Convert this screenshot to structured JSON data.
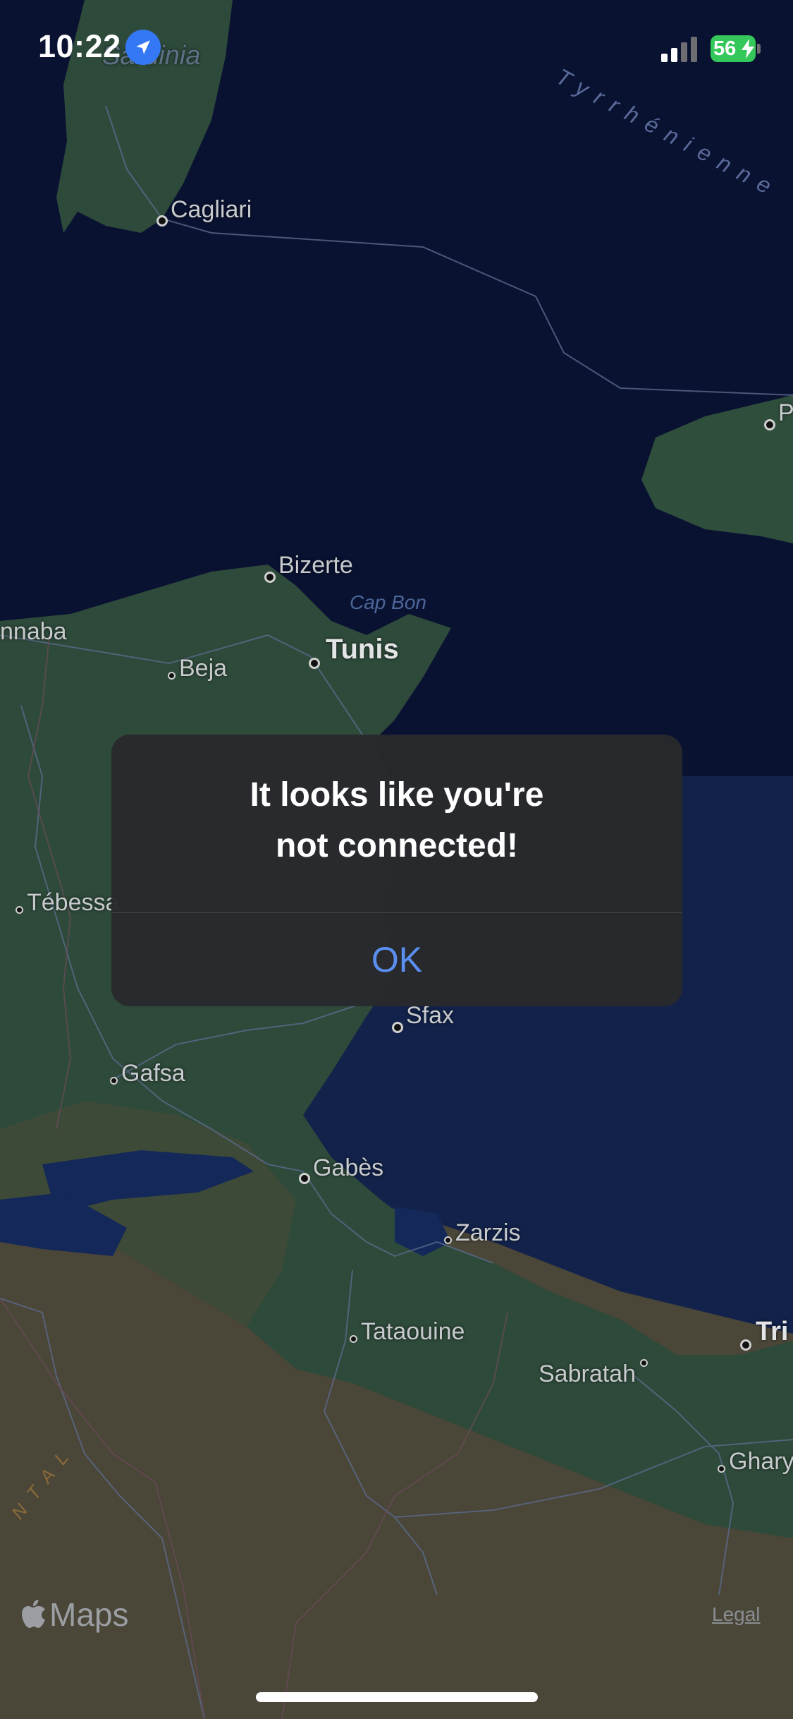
{
  "status_bar": {
    "time": "10:22",
    "battery_level": "56",
    "icons": [
      "location-arrow-icon",
      "signal-icon",
      "battery-charging-icon"
    ]
  },
  "map": {
    "places": {
      "sardinia": "Sardinia",
      "tyrrhenian": "Tyrrhénienne",
      "cagliari": "Cagliari",
      "palermo": "P",
      "bizerte": "Bizerte",
      "cap_bon": "Cap Bon",
      "annaba": "nnaba",
      "tunis": "Tunis",
      "beja": "Beja",
      "tebessa": "Tébessa",
      "sfax": "Sfax",
      "gafsa": "Gafsa",
      "gabes": "Gabès",
      "zarzis": "Zarzis",
      "tataouine": "Tataouine",
      "sabratah": "Sabratah",
      "tripoli": "Tri",
      "gharyan": "Gharya",
      "oriental": "NTAL"
    }
  },
  "alert": {
    "title_line1": "It looks like you're",
    "title_line2": "not connected!",
    "ok_label": "OK"
  },
  "footer": {
    "maps_label": "Maps",
    "legal_label": "Legal"
  },
  "colors": {
    "sea": "#0b1330",
    "land_green": "#2c4a3a",
    "desert": "#4a4638",
    "accent": "#5a8ff0",
    "battery": "#34c759"
  }
}
